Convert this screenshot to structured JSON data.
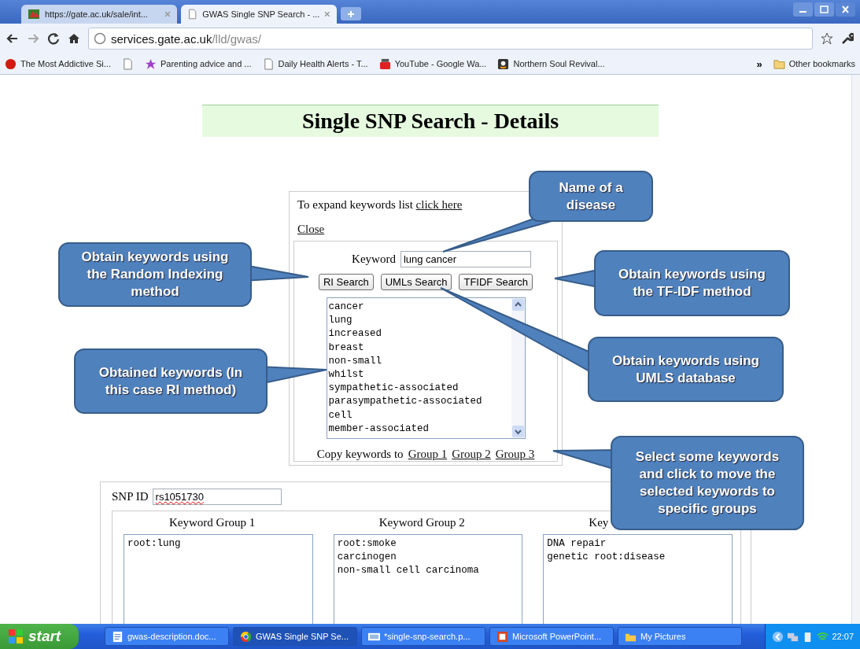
{
  "browser": {
    "tabs": [
      {
        "title": "https://gate.ac.uk/sale/int...",
        "kind": "logo",
        "selected": false
      },
      {
        "title": "GWAS Single SNP Search - ...",
        "kind": "page",
        "selected": true
      }
    ],
    "address": {
      "host": "services.gate.ac.uk",
      "path": "/lld/gwas/"
    },
    "bookmarks": [
      {
        "label": "The Most Addictive Si...",
        "kind": "dot"
      },
      {
        "kind": "page"
      },
      {
        "label": "Parenting advice and ...",
        "kind": "star"
      },
      {
        "label": "Daily Health Alerts - T...",
        "kind": "page"
      },
      {
        "label": "YouTube - Google Wa...",
        "kind": "video"
      },
      {
        "label": "Northern Soul Revival...",
        "kind": "letter"
      }
    ],
    "more": "»",
    "other_bookmarks": "Other bookmarks"
  },
  "page": {
    "title": "Single SNP Search - Details",
    "expand_text": "To expand keywords list",
    "expand_link": "click here",
    "close_link": "Close",
    "keyword_label": "Keyword",
    "keyword_value": "lung cancer",
    "buttons": [
      "RI Search",
      "UMLs Search",
      "TFIDF Search"
    ],
    "keywords": [
      "cancer",
      "lung",
      "increased",
      "breast",
      "non-small",
      "whilst",
      "sympathetic-associated",
      "parasympathetic-associated",
      "cell",
      "member-associated"
    ],
    "copy_label": "Copy keywords to",
    "copy_links": [
      "Group 1",
      "Group 2",
      "Group 3"
    ],
    "snp_label": "SNP ID",
    "snp_value": "rs1051730",
    "groups": [
      {
        "heading": "Keyword Group 1",
        "items": [
          "root:lung"
        ]
      },
      {
        "heading": "Keyword Group 2",
        "items": [
          "root:smoke",
          "carcinogen",
          "non-small cell carcinoma"
        ]
      },
      {
        "heading": "Key",
        "items": [
          "DNA repair",
          "genetic root:disease"
        ]
      }
    ]
  },
  "callouts": [
    "Name of a disease",
    "Obtain keywords using the Random Indexing method",
    "Obtain keywords using the TF-IDF method",
    "Obtain keywords using UMLS database",
    "Obtained keywords (In this case RI method)",
    "Select some keywords and click to move the selected keywords to specific groups"
  ],
  "taskbar": {
    "start": "start",
    "items": [
      {
        "label": "gwas-description.doc...",
        "kind": "doc",
        "selected": false
      },
      {
        "label": "GWAS Single SNP Se...",
        "kind": "browser",
        "selected": true
      },
      {
        "label": "*single-snp-search.p...",
        "kind": "image",
        "selected": false
      },
      {
        "label": "Microsoft PowerPoint...",
        "kind": "slides",
        "selected": false
      },
      {
        "label": "My Pictures",
        "kind": "folder",
        "selected": false
      }
    ],
    "clock": "22:07"
  }
}
